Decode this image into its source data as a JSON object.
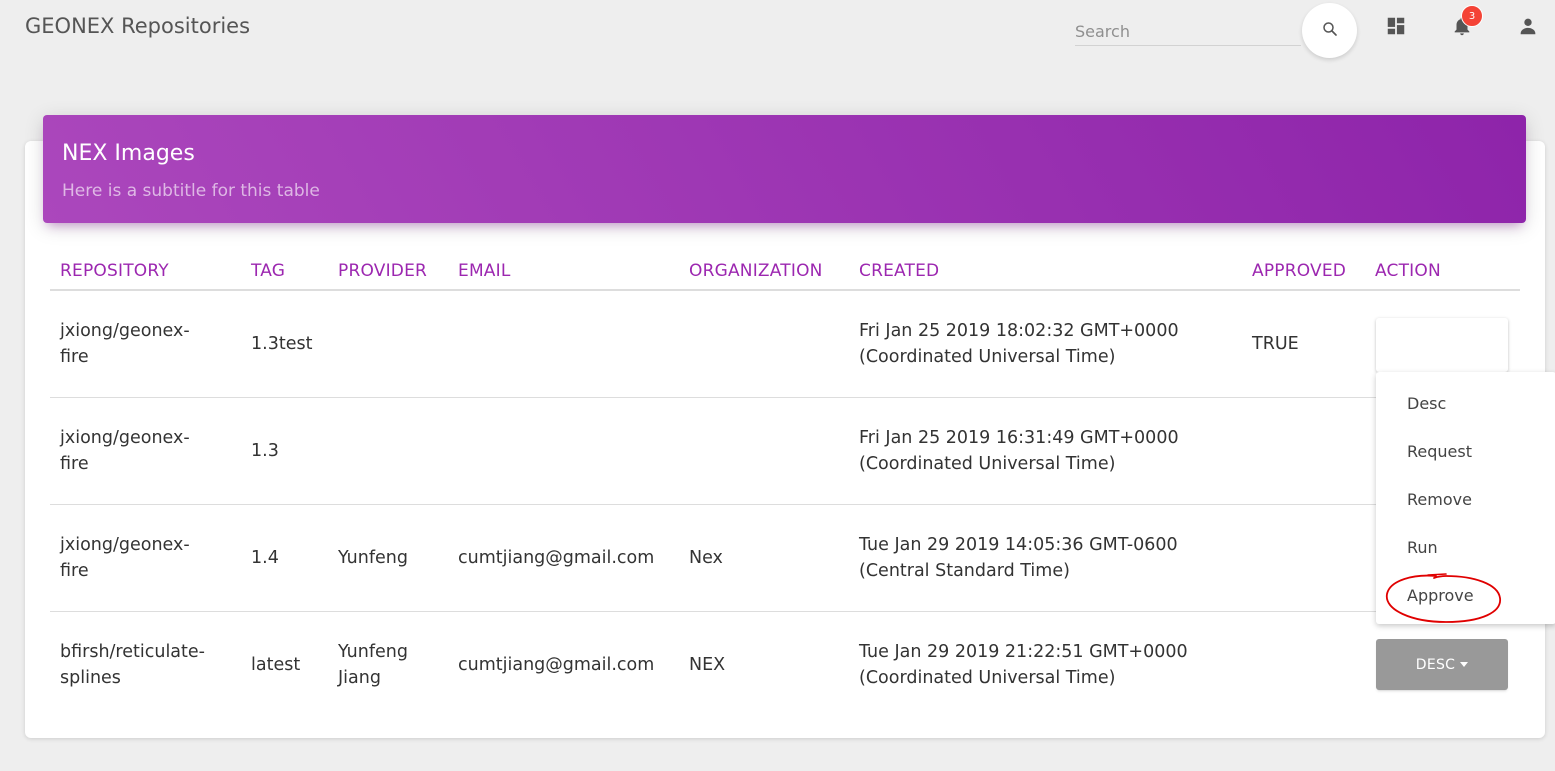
{
  "app": {
    "title": "GEONEX Repositories"
  },
  "header": {
    "search": {
      "placeholder": "Search",
      "value": ""
    },
    "notifications": {
      "count": "3"
    },
    "icons": [
      "search-icon",
      "dashboard-icon",
      "bell-icon",
      "person-icon"
    ]
  },
  "card": {
    "title": "NEX Images",
    "subtitle": "Here is a subtitle for this table"
  },
  "table": {
    "columns": [
      "REPOSITORY",
      "TAG",
      "PROVIDER",
      "EMAIL",
      "ORGANIZATION",
      "CREATED",
      "APPROVED",
      "ACTION"
    ],
    "rows": [
      {
        "repository": [
          "jxiong/geonex-",
          "fire"
        ],
        "tag": "1.3test",
        "provider": [],
        "email": "",
        "organization": "",
        "created": [
          "Fri Jan 25 2019 18:02:32 GMT+0000",
          "(Coordinated Universal Time)"
        ],
        "approved": "TRUE"
      },
      {
        "repository": [
          "jxiong/geonex-",
          "fire"
        ],
        "tag": "1.3",
        "provider": [],
        "email": "",
        "organization": "",
        "created": [
          "Fri Jan 25 2019 16:31:49 GMT+0000",
          "(Coordinated Universal Time)"
        ],
        "approved": ""
      },
      {
        "repository": [
          "jxiong/geonex-",
          "fire"
        ],
        "tag": "1.4",
        "provider": [
          "Yunfeng"
        ],
        "email": "cumtjiang@gmail.com",
        "organization": "Nex",
        "created": [
          "Tue Jan 29 2019 14:05:36 GMT-0600",
          "(Central Standard Time)"
        ],
        "approved": ""
      },
      {
        "repository": [
          "bfirsh/reticulate-",
          "splines"
        ],
        "tag": "latest",
        "provider": [
          "Yunfeng",
          "Jiang"
        ],
        "email": "cumtjiang@gmail.com",
        "organization": "NEX",
        "created": [
          "Tue Jan 29 2019 21:22:51 GMT+0000",
          "(Coordinated Universal Time)"
        ],
        "approved": ""
      }
    ]
  },
  "action_menu": {
    "items": [
      "Desc",
      "Request",
      "Remove",
      "Run",
      "Approve"
    ],
    "button_label": "DESC"
  },
  "colors": {
    "accent": "#9c27b0",
    "header_gradient_start": "#ab47bc",
    "header_gradient_end": "#8e24aa",
    "badge": "#f44336",
    "annotation": "#e00000",
    "button_gray": "#999999"
  }
}
